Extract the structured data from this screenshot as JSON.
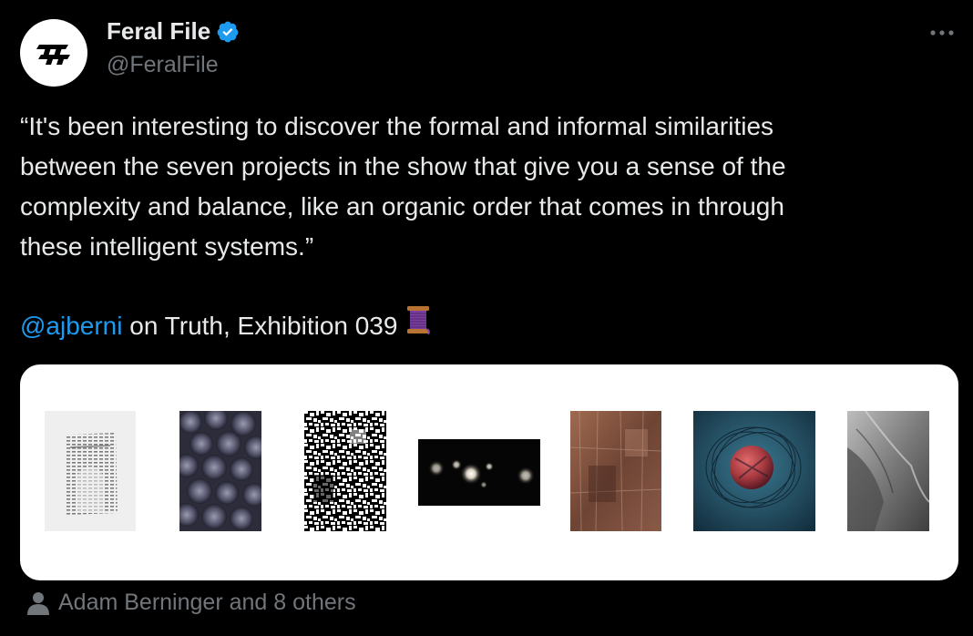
{
  "author": {
    "display_name": "Feral File",
    "handle": "@FeralFile",
    "verified": true,
    "avatar_icon": "feral-file-logo"
  },
  "tweet": {
    "text_lines": [
      "“It's been interesting to discover the formal and informal similarities",
      "between the seven projects in the show that give you a sense of the",
      "complexity and balance, like an organic order that comes in through",
      "these intelligent systems.”"
    ],
    "mention": "@ajberni",
    "mention_suffix": " on Truth, Exhibition 039",
    "emoji": "spool-of-thread-emoji"
  },
  "media": {
    "artworks": [
      "artwork-1",
      "artwork-2",
      "artwork-3",
      "artwork-4",
      "artwork-5",
      "artwork-6",
      "artwork-7"
    ]
  },
  "tagged": {
    "label": "Adam Berninger and 8 others",
    "icon": "person-icon"
  },
  "colors": {
    "background": "#000000",
    "text": "#e7e9ea",
    "secondary": "#71767b",
    "link": "#1d9bf0",
    "verified": "#1d9bf0"
  }
}
